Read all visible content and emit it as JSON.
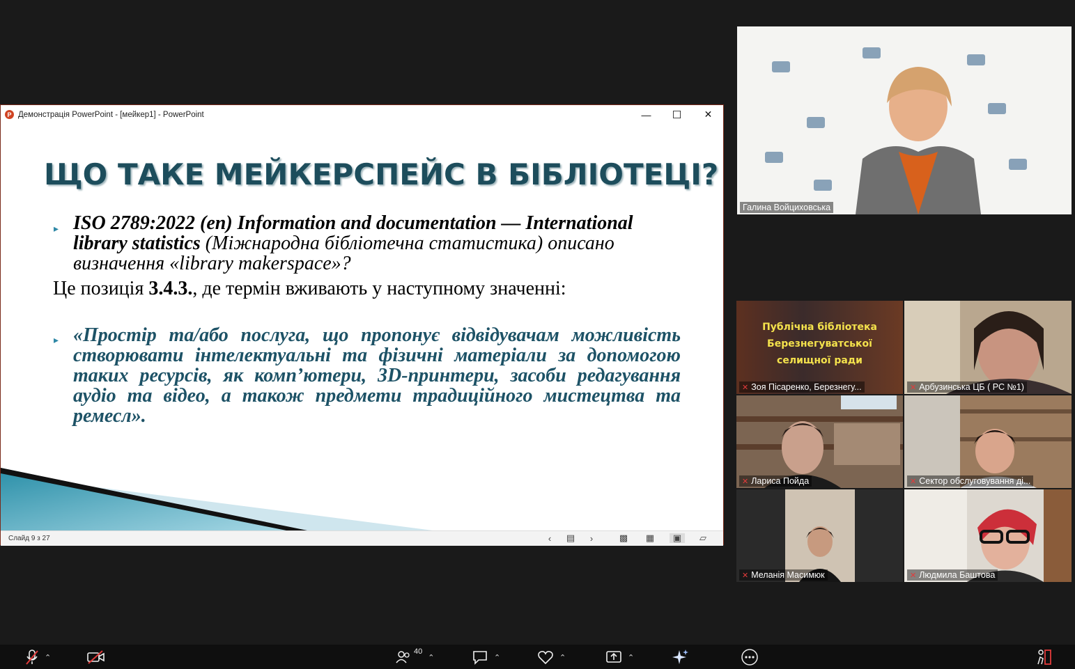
{
  "ppt": {
    "window_title": "Демонстрація PowerPoint - [мейкер1] - PowerPoint",
    "controls": {
      "minimize": "—",
      "maximize": "☐",
      "close": "✕"
    },
    "slide": {
      "title": "ЩО ТАКЕ МЕЙКЕРСПЕЙС В БІБЛІОТЕЦІ?",
      "bullet1_bold": "ISO 2789:2022 (en) Information and documentation — International library statistics",
      "bullet1_rest": " (Міжнародна бібліотечна статистика) описано визначення «library makerspace»?",
      "line2_pre": "Це позиція ",
      "line2_bold": "3.4.3.",
      "line2_post": ", де термін вживають у наступному значенні:",
      "bullet3": "«Простір та/або послуга, що пропонує відвідувачам можливість створювати інтелектуальні та фізичні матеріали за допомогою таких ресурсів, як комп’ютери, 3D-принтери, засоби редагування аудіо та відео, а також предмети традиційного мистецтва та ремесл»."
    },
    "status": {
      "slide_counter": "Слайд 9 з 27"
    }
  },
  "participants": [
    {
      "name": "Галина Войциховська"
    },
    {
      "name": "Зоя Пісаренко, Березнегу..."
    },
    {
      "name": "Арбузинська ЦБ ( РС №1)"
    },
    {
      "name": "Лариса Пойда"
    },
    {
      "name": "Сектор обслуговування ді..."
    },
    {
      "name": "Меланія Масимюк"
    },
    {
      "name": "Людмила Баштова"
    }
  ],
  "tile_banner": {
    "line1": "Публічна бібліотека",
    "line2": "Березнегуватської",
    "line3": "селищної ради"
  },
  "toolbar": {
    "participants_count": "40"
  },
  "colors": {
    "title": "#1d4d5c",
    "accent": "#2e88a6",
    "quote": "#1d5266",
    "muted": "#e23b3b"
  }
}
